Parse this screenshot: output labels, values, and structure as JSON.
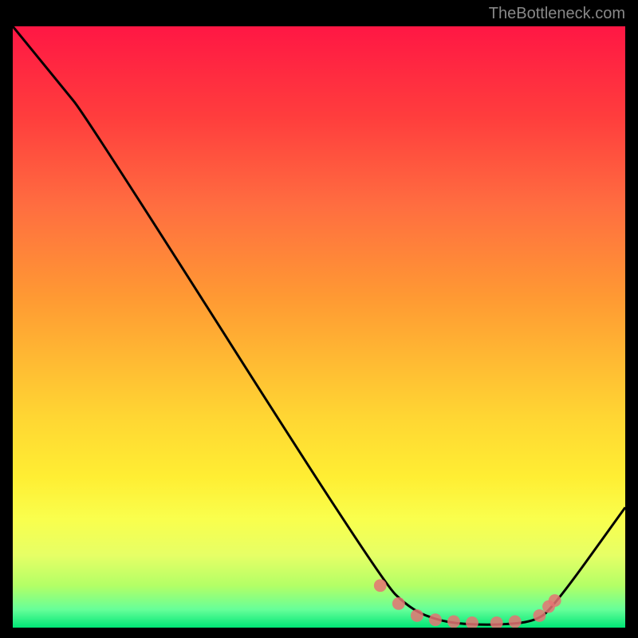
{
  "watermark": "TheBottleneck.com",
  "chart_data": {
    "type": "line",
    "title": "",
    "xlabel": "",
    "ylabel": "",
    "xlim": [
      0,
      100
    ],
    "ylim": [
      0,
      100
    ],
    "series": [
      {
        "name": "curve",
        "x": [
          0,
          8,
          12,
          60,
          65,
          70,
          75,
          80,
          85,
          88,
          100
        ],
        "y": [
          100,
          90,
          85,
          8,
          3,
          1,
          0.5,
          0.5,
          1,
          3,
          20
        ]
      }
    ],
    "markers": {
      "x": [
        60,
        63,
        66,
        69,
        72,
        75,
        79,
        82,
        86,
        87.5,
        88.5
      ],
      "y": [
        7,
        4,
        2,
        1.3,
        1,
        0.8,
        0.8,
        1,
        2,
        3.5,
        4.5
      ]
    },
    "gradient_stops": [
      {
        "offset": 0,
        "color": "#ff1744"
      },
      {
        "offset": 15,
        "color": "#ff3d3d"
      },
      {
        "offset": 30,
        "color": "#ff6e40"
      },
      {
        "offset": 45,
        "color": "#ff9933"
      },
      {
        "offset": 55,
        "color": "#ffb833"
      },
      {
        "offset": 65,
        "color": "#ffd633"
      },
      {
        "offset": 75,
        "color": "#ffee33"
      },
      {
        "offset": 82,
        "color": "#f9ff4d"
      },
      {
        "offset": 88,
        "color": "#e6ff66"
      },
      {
        "offset": 93,
        "color": "#b3ff66"
      },
      {
        "offset": 97,
        "color": "#66ff99"
      },
      {
        "offset": 100,
        "color": "#00e676"
      }
    ]
  }
}
